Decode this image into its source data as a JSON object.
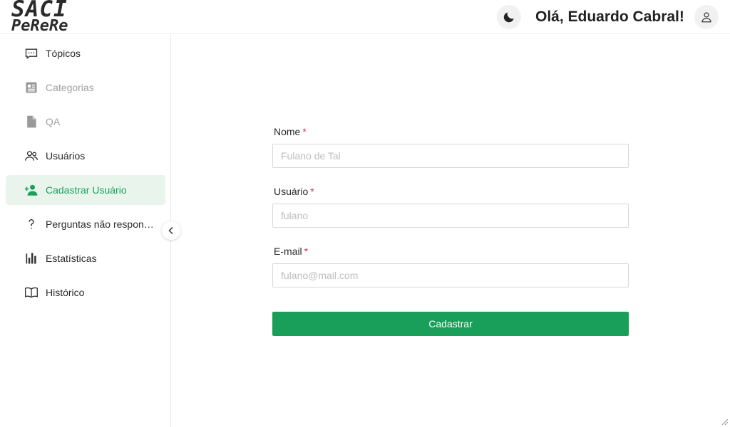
{
  "header": {
    "logo_line1": "SACI",
    "logo_line2": "PeReRe",
    "greeting": "Olá, Eduardo Cabral!",
    "theme_icon": "moon-icon",
    "user_icon": "user-icon"
  },
  "sidebar": {
    "items": [
      {
        "label": "Tópicos",
        "icon": "chat-icon",
        "state": "normal"
      },
      {
        "label": "Categorias",
        "icon": "newspaper-icon",
        "state": "disabled"
      },
      {
        "label": "QA",
        "icon": "file-icon",
        "state": "disabled"
      },
      {
        "label": "Usuários",
        "icon": "users-icon",
        "state": "normal"
      },
      {
        "label": "Cadastrar Usuário",
        "icon": "user-add-icon",
        "state": "active"
      },
      {
        "label": "Perguntas não respondidas",
        "icon": "question-icon",
        "state": "normal"
      },
      {
        "label": "Estatísticas",
        "icon": "bar-chart-icon",
        "state": "normal"
      },
      {
        "label": "Histórico",
        "icon": "book-icon",
        "state": "normal"
      }
    ],
    "collapse_icon": "chevron-left-icon"
  },
  "form": {
    "name_label": "Nome",
    "name_placeholder": "Fulano de Tal",
    "name_value": "",
    "username_label": "Usuário",
    "username_placeholder": "fulano",
    "username_value": "",
    "email_label": "E-mail",
    "email_placeholder": "fulano@mail.com",
    "email_value": "",
    "required_mark": "*",
    "submit_label": "Cadastrar"
  },
  "colors": {
    "accent": "#1a9f5a",
    "active_bg": "#e9f5ec",
    "required": "#d6334a",
    "disabled_text": "#a0a0a0"
  }
}
